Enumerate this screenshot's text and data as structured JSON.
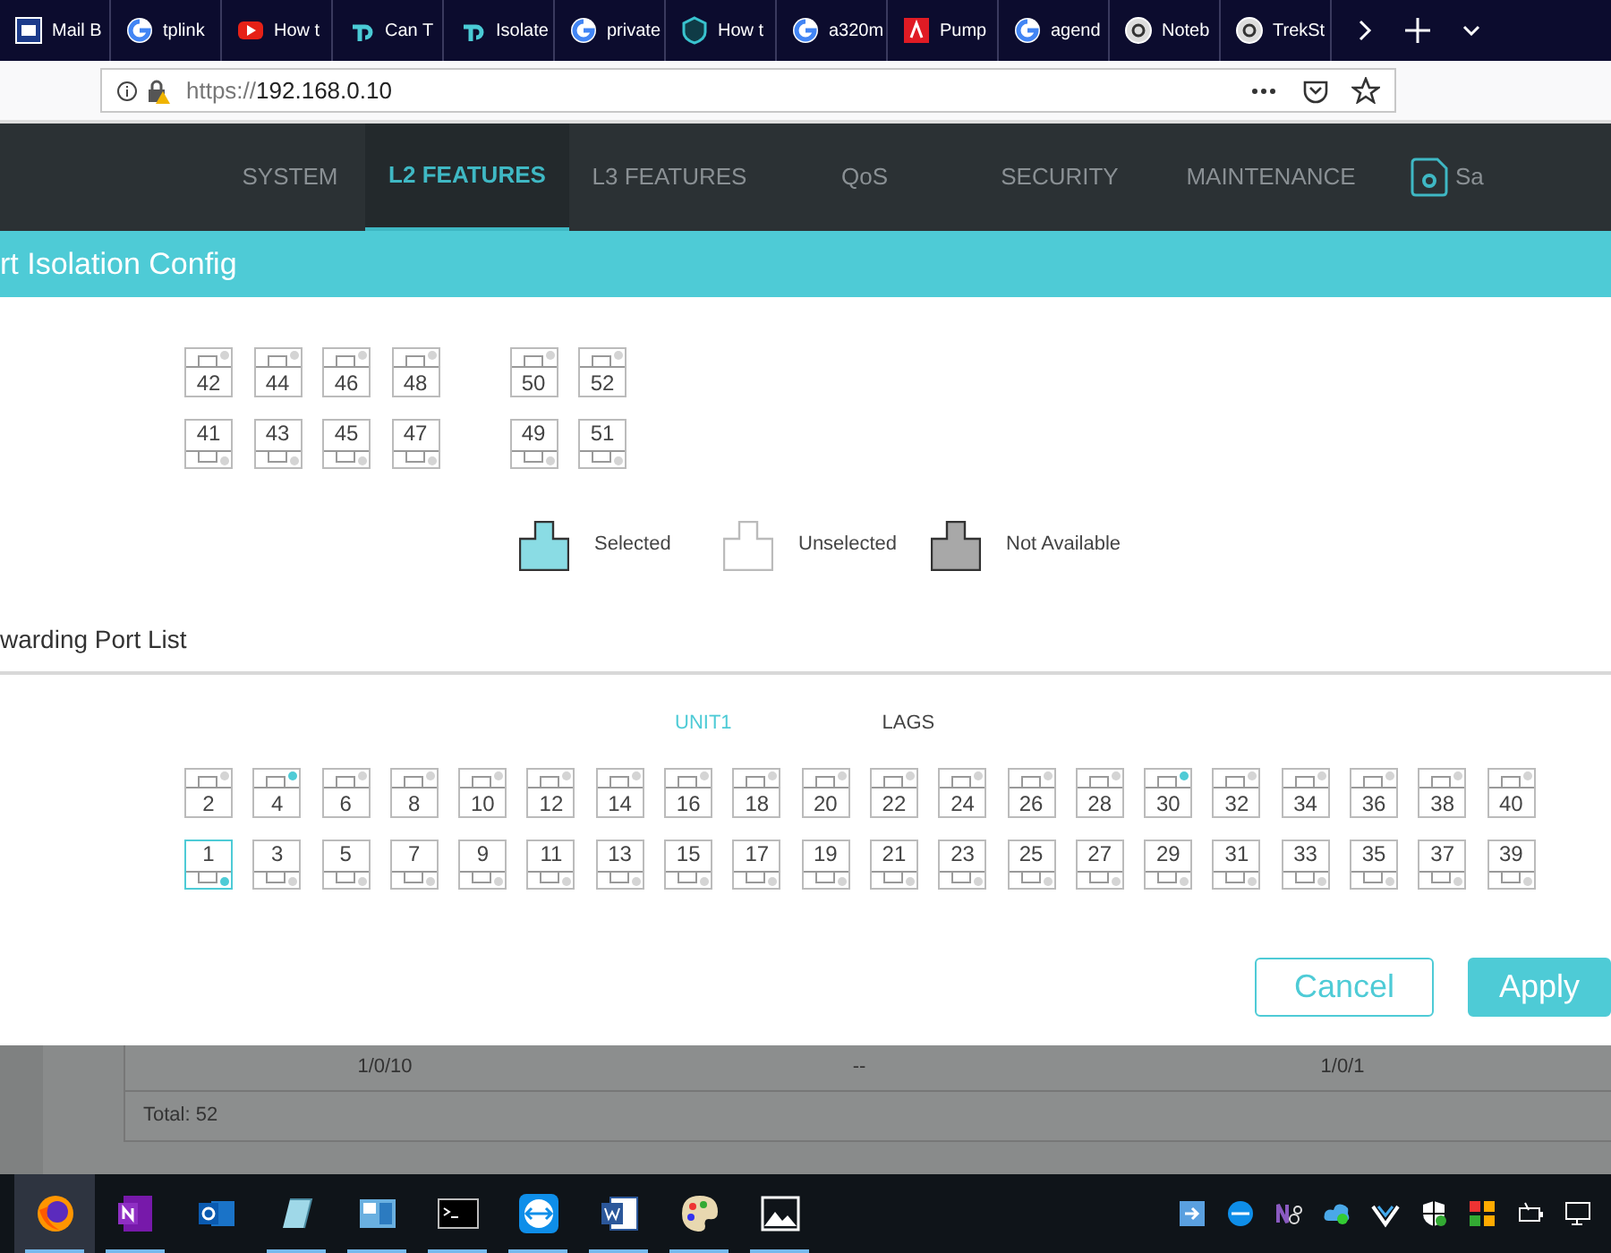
{
  "browser_tabs": [
    {
      "title": "Mail B",
      "kind": "mail"
    },
    {
      "title": "tplink",
      "kind": "google"
    },
    {
      "title": "How t",
      "kind": "video"
    },
    {
      "title": "Can T",
      "kind": "tplink"
    },
    {
      "title": "Isolate",
      "kind": "tplink"
    },
    {
      "title": "private",
      "kind": "google"
    },
    {
      "title": "How t",
      "kind": "shield"
    },
    {
      "title": "a320m",
      "kind": "google"
    },
    {
      "title": "Pump",
      "kind": "pdf"
    },
    {
      "title": "agend",
      "kind": "google"
    },
    {
      "title": "Noteb",
      "kind": "circle"
    },
    {
      "title": "TrekSt",
      "kind": "circle"
    }
  ],
  "address_bar": {
    "scheme": "https://",
    "host": "192.168.0.10"
  },
  "nav": {
    "items": [
      {
        "label": "SYSTEM",
        "selected": false
      },
      {
        "label": "L2 FEATURES",
        "selected": true
      },
      {
        "label": "L3 FEATURES",
        "selected": false
      },
      {
        "label": "QoS",
        "selected": false
      },
      {
        "label": "SECURITY",
        "selected": false
      },
      {
        "label": "MAINTENANCE",
        "selected": false
      }
    ],
    "save_label": "Sa"
  },
  "dialog": {
    "title": "rt Isolation Config",
    "upper_groups": [
      {
        "top": [
          {
            "label": "42",
            "selected": false,
            "link_up": false
          },
          {
            "label": "44",
            "selected": false,
            "link_up": false
          },
          {
            "label": "46",
            "selected": false,
            "link_up": false
          },
          {
            "label": "48",
            "selected": false,
            "link_up": false
          }
        ],
        "bottom": [
          {
            "label": "41",
            "selected": false,
            "link_up": false
          },
          {
            "label": "43",
            "selected": false,
            "link_up": false
          },
          {
            "label": "45",
            "selected": false,
            "link_up": false
          },
          {
            "label": "47",
            "selected": false,
            "link_up": false
          }
        ]
      },
      {
        "top": [
          {
            "label": "50",
            "selected": false,
            "link_up": false
          },
          {
            "label": "52",
            "selected": false,
            "link_up": false
          }
        ],
        "bottom": [
          {
            "label": "49",
            "selected": false,
            "link_up": false
          },
          {
            "label": "51",
            "selected": false,
            "link_up": false
          }
        ]
      }
    ],
    "legend": [
      {
        "kind": "selected",
        "label": "Selected"
      },
      {
        "kind": "unselected",
        "label": "Unselected"
      },
      {
        "kind": "unavailable",
        "label": "Not Available"
      }
    ],
    "section_title": "warding Port List",
    "unit_tabs": [
      {
        "label": "UNIT1",
        "selected": true
      },
      {
        "label": "LAGS",
        "selected": false
      }
    ],
    "ports_top": [
      {
        "label": "2",
        "selected": false,
        "link_up": false
      },
      {
        "label": "4",
        "selected": false,
        "link_up": true
      },
      {
        "label": "6",
        "selected": false,
        "link_up": false
      },
      {
        "label": "8",
        "selected": false,
        "link_up": false
      },
      {
        "label": "10",
        "selected": false,
        "link_up": false
      },
      {
        "label": "12",
        "selected": false,
        "link_up": false
      },
      {
        "label": "14",
        "selected": false,
        "link_up": false
      },
      {
        "label": "16",
        "selected": false,
        "link_up": false
      },
      {
        "label": "18",
        "selected": false,
        "link_up": false
      },
      {
        "label": "20",
        "selected": false,
        "link_up": false
      },
      {
        "label": "22",
        "selected": false,
        "link_up": false
      },
      {
        "label": "24",
        "selected": false,
        "link_up": false
      },
      {
        "label": "26",
        "selected": false,
        "link_up": false
      },
      {
        "label": "28",
        "selected": false,
        "link_up": false
      },
      {
        "label": "30",
        "selected": false,
        "link_up": true
      },
      {
        "label": "32",
        "selected": false,
        "link_up": false
      },
      {
        "label": "34",
        "selected": false,
        "link_up": false
      },
      {
        "label": "36",
        "selected": false,
        "link_up": false
      },
      {
        "label": "38",
        "selected": false,
        "link_up": false
      },
      {
        "label": "40",
        "selected": false,
        "link_up": false
      }
    ],
    "ports_bottom": [
      {
        "label": "1",
        "selected": true,
        "link_up": true
      },
      {
        "label": "3",
        "selected": false,
        "link_up": false
      },
      {
        "label": "5",
        "selected": false,
        "link_up": false
      },
      {
        "label": "7",
        "selected": false,
        "link_up": false
      },
      {
        "label": "9",
        "selected": false,
        "link_up": false
      },
      {
        "label": "11",
        "selected": false,
        "link_up": false
      },
      {
        "label": "13",
        "selected": false,
        "link_up": false
      },
      {
        "label": "15",
        "selected": false,
        "link_up": false
      },
      {
        "label": "17",
        "selected": false,
        "link_up": false
      },
      {
        "label": "19",
        "selected": false,
        "link_up": false
      },
      {
        "label": "21",
        "selected": false,
        "link_up": false
      },
      {
        "label": "23",
        "selected": false,
        "link_up": false
      },
      {
        "label": "25",
        "selected": false,
        "link_up": false
      },
      {
        "label": "27",
        "selected": false,
        "link_up": false
      },
      {
        "label": "29",
        "selected": false,
        "link_up": false
      },
      {
        "label": "31",
        "selected": false,
        "link_up": false
      },
      {
        "label": "33",
        "selected": false,
        "link_up": false
      },
      {
        "label": "35",
        "selected": false,
        "link_up": false
      },
      {
        "label": "37",
        "selected": false,
        "link_up": false
      },
      {
        "label": "39",
        "selected": false,
        "link_up": false
      }
    ],
    "buttons": [
      {
        "kind": "secondary",
        "label": "Cancel"
      },
      {
        "kind": "primary",
        "label": "Apply"
      }
    ]
  },
  "background_table": {
    "row": [
      "1/0/10",
      "--",
      "1/0/1"
    ],
    "footer": "Total: 52"
  },
  "taskbar": {
    "apps": [
      {
        "kind": "browser",
        "active": true,
        "running": true
      },
      {
        "kind": "notes",
        "active": false,
        "running": true
      },
      {
        "kind": "mail",
        "active": false,
        "running": false
      },
      {
        "kind": "editor",
        "active": false,
        "running": true
      },
      {
        "kind": "panel",
        "active": false,
        "running": true
      },
      {
        "kind": "terminal",
        "active": false,
        "running": true
      },
      {
        "kind": "remote",
        "active": false,
        "running": true
      },
      {
        "kind": "document",
        "active": false,
        "running": true
      },
      {
        "kind": "paint",
        "active": false,
        "running": true
      },
      {
        "kind": "photos",
        "active": false,
        "running": true
      }
    ]
  }
}
